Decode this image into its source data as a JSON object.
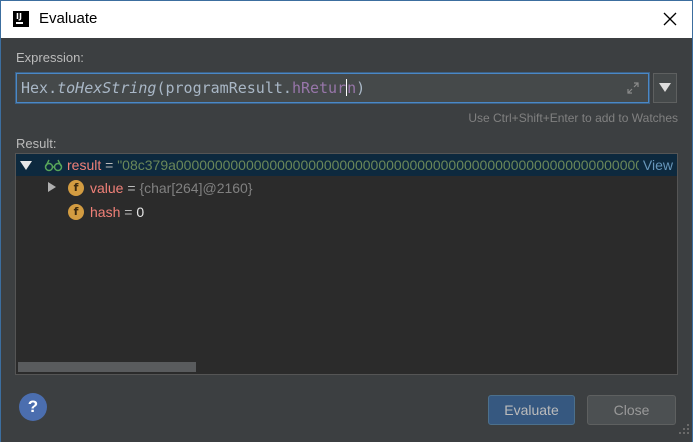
{
  "window": {
    "title": "Evaluate",
    "app_icon": "intellij-icon",
    "close_icon": "close-icon"
  },
  "expression": {
    "label": "Expression:",
    "parts": {
      "class": "Hex",
      "dot": ".",
      "method": "toHexString",
      "open": "(",
      "arg": "programResult",
      "dot2": ".",
      "field": "hRetur",
      "field_end": "n",
      "close": ")"
    },
    "expand_icon": "expand-icon",
    "history_icon": "dropdown-arrow-icon",
    "hint": "Use Ctrl+Shift+Enter to add to Watches"
  },
  "result": {
    "label": "Result:",
    "root": {
      "name": "result",
      "eq": " = ",
      "value": "\"08c379a00000000000000000000000000000000000000000000000000000000000000…",
      "link": "View",
      "icon": "watch-glasses-icon",
      "expanded": true
    },
    "children": [
      {
        "icon": "field-f-icon",
        "icon_letter": "f",
        "name": "value",
        "eq": " = ",
        "value": "{char[264]@2160}",
        "expandable": true
      },
      {
        "icon": "field-f-icon",
        "icon_letter": "f",
        "name": "hash",
        "eq": " = ",
        "value": "0",
        "expandable": false
      }
    ]
  },
  "buttons": {
    "help": "?",
    "evaluate": "Evaluate",
    "close": "Close"
  },
  "colors": {
    "background": "#3c3f41",
    "tree_bg": "#2b2b2b",
    "selection": "#0d293e",
    "accent": "#4a88c7",
    "field_icon": "#d39c41",
    "string": "#6a8759",
    "name": "#f08078"
  }
}
